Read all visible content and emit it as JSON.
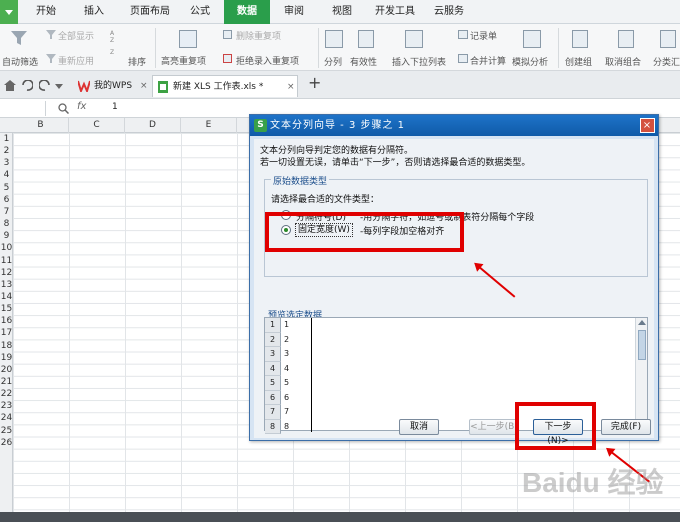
{
  "menu": {
    "tabs": [
      "开始",
      "插入",
      "页面布局",
      "公式",
      "数据",
      "审阅",
      "视图",
      "开发工具",
      "云服务"
    ],
    "active": "数据"
  },
  "ribbon": {
    "show_all": "全部显示",
    "reapply": "重新应用",
    "auto_filter": "自动筛选",
    "sort": "排序",
    "highlight_dup": "高亮重复项",
    "delete_dup": "删除重复项",
    "reject_dup": "拒绝录入重复项",
    "split": "分列",
    "validity": "有效性",
    "insert_dropdown": "插入下拉列表",
    "record_form": "记录单",
    "merge_calc": "合并计算",
    "simulate": "模拟分析",
    "create_group": "创建组",
    "ungroup": "取消组合",
    "subtotal": "分类汇"
  },
  "doctabs": {
    "wps": "我的WPS",
    "file": "新建 XLS 工作表.xls *",
    "add": "+"
  },
  "formula": {
    "cell_value": "1",
    "fx": "fx"
  },
  "sheet": {
    "columns": [
      "B",
      "C",
      "D",
      "E"
    ],
    "rows": [
      "1",
      "2",
      "3",
      "4",
      "5",
      "6",
      "7",
      "8",
      "9",
      "10",
      "11",
      "12",
      "13",
      "14",
      "15",
      "16",
      "17",
      "18",
      "19",
      "20",
      "21",
      "22",
      "23",
      "24",
      "25",
      "26"
    ]
  },
  "dialog": {
    "title": "文本分列向导 - 3 步骤之 1",
    "close": "×",
    "intro1": "文本分列向导判定您的数据有分隔符。",
    "intro2": "若一切设置无误，请单击“下一步”，否则请选择最合适的数据类型。",
    "group_type": "原始数据类型",
    "choose_label": "请选择最合适的文件类型：",
    "opt_delimited": "分隔符号(D)",
    "opt_delimited_desc": "-用分隔字符，如逗号或制表符分隔每个字段",
    "opt_fixed": "固定宽度(W)",
    "opt_fixed_desc": "-每列字段加空格对齐",
    "preview_label": "预览选定数据",
    "preview_rows": [
      {
        "n": "1",
        "v": "1"
      },
      {
        "n": "2",
        "v": "2"
      },
      {
        "n": "3",
        "v": "3"
      },
      {
        "n": "4",
        "v": "4"
      },
      {
        "n": "5",
        "v": "5"
      },
      {
        "n": "6",
        "v": "6"
      },
      {
        "n": "7",
        "v": "7"
      },
      {
        "n": "8",
        "v": "8"
      }
    ],
    "btn_cancel": "取消",
    "btn_prev": "<上一步(B)",
    "btn_next": "下一步(N)>",
    "btn_finish": "完成(F)"
  },
  "watermark": "Baidu 经验",
  "colors": {
    "tab_active": "#2a9e4b",
    "dialog_title": "#1e73c8",
    "highlight": "#e00000"
  }
}
